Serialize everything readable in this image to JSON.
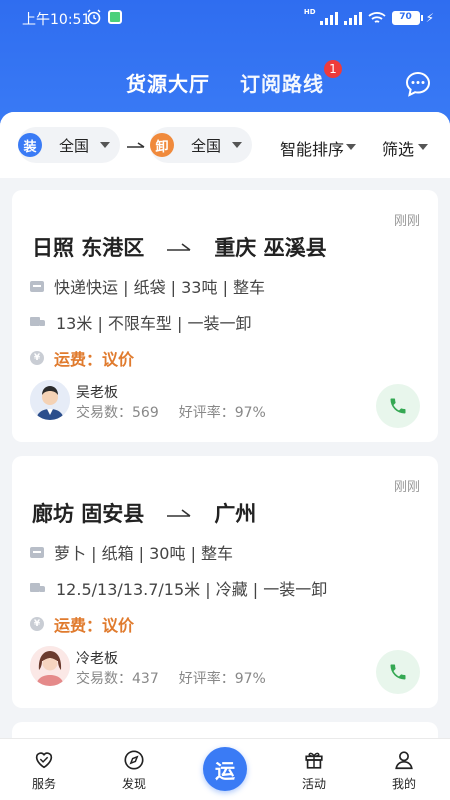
{
  "status_bar": {
    "time": "上午10:51",
    "battery": "70"
  },
  "header": {
    "tabs": [
      {
        "label": "货源大厅"
      },
      {
        "label": "订阅路线",
        "badge": "1"
      }
    ],
    "message_icon": "chat-icon"
  },
  "filters": {
    "load": {
      "tag": "装",
      "value": "全国"
    },
    "unload": {
      "tag": "卸",
      "value": "全国"
    },
    "sort_label": "智能排序",
    "filter_label": "筛选"
  },
  "listings": [
    {
      "time": "刚刚",
      "from": "日照 东港区",
      "to": "重庆 巫溪县",
      "cargo": "快递快运 | 纸袋 | 33吨 | 整车",
      "vehicle": "13米 | 不限车型 | 一装一卸",
      "fare": "运费：议价",
      "contact": {
        "name": "吴老板",
        "trades": "交易数：569",
        "rating": "好评率：97%"
      }
    },
    {
      "time": "刚刚",
      "from": "廊坊 固安县",
      "to": "广州",
      "cargo": "萝卜 | 纸箱 | 30吨 | 整车",
      "vehicle": "12.5/13/13.7/15米 | 冷藏 | 一装一卸",
      "fare": "运费：议价",
      "contact": {
        "name": "冷老板",
        "trades": "交易数：437",
        "rating": "好评率：97%"
      }
    }
  ],
  "bottom_nav": [
    {
      "label": "服务",
      "icon": "heart-icon"
    },
    {
      "label": "发现",
      "icon": "compass-icon"
    },
    {
      "label": "运",
      "icon": "yun-icon"
    },
    {
      "label": "活动",
      "icon": "gift-icon"
    },
    {
      "label": "我的",
      "icon": "person-icon"
    }
  ],
  "colors": {
    "primary": "#3a7bf5",
    "fare": "#e07b2e",
    "badge": "#ee3b3b",
    "call": "#35a853"
  }
}
